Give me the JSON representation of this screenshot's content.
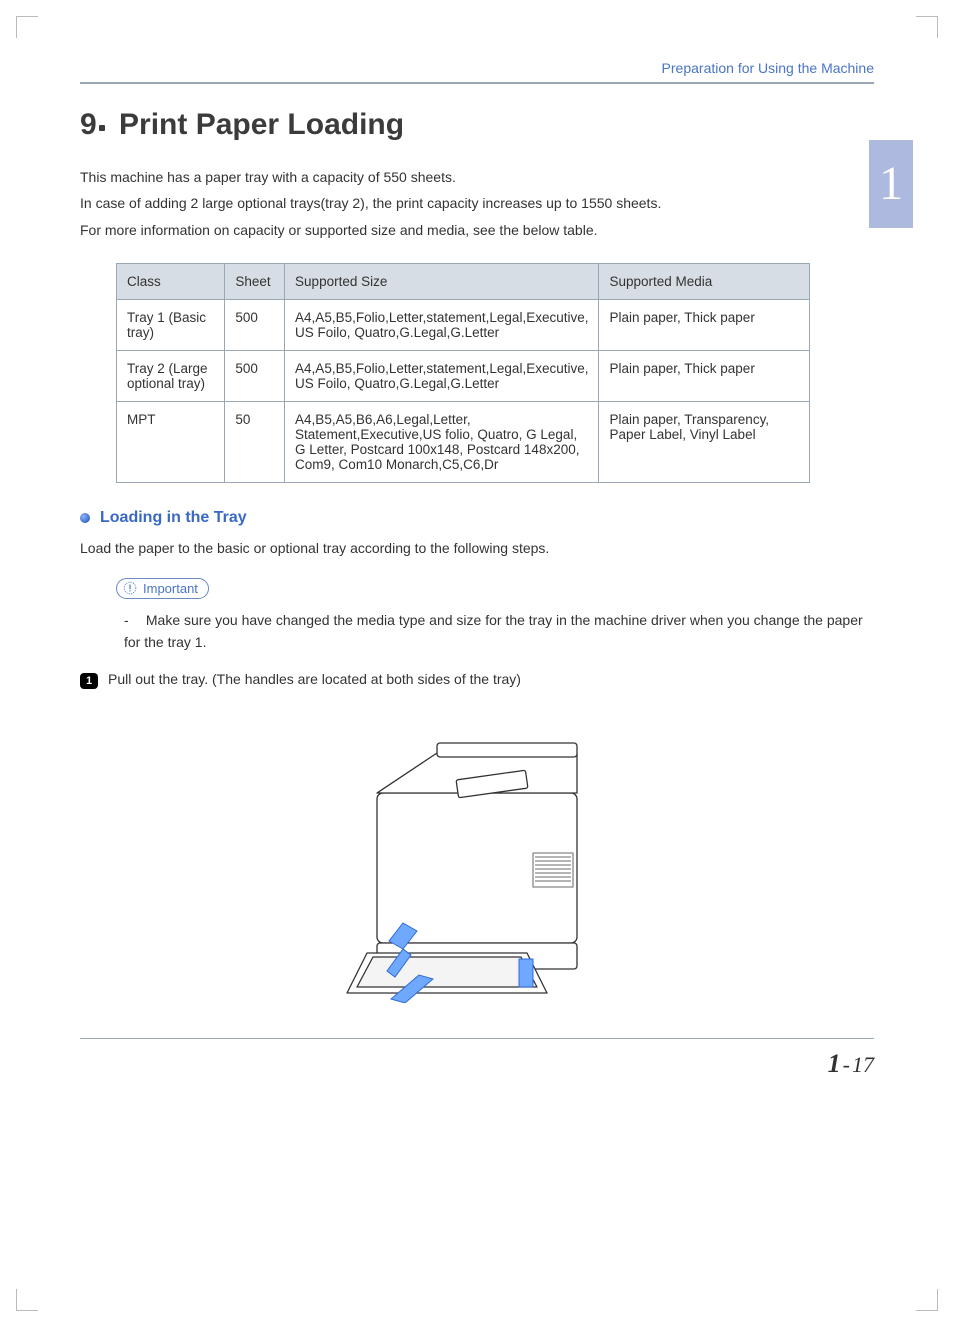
{
  "header": {
    "link_text": "Preparation for Using the Machine"
  },
  "side_tab": {
    "label": "1"
  },
  "title": {
    "number": "9",
    "text": "Print Paper Loading"
  },
  "intro": {
    "p1": "This machine has a paper tray with a capacity of 550 sheets.",
    "p2": "In case of adding 2 large optional trays(tray 2), the print capacity increases up to 1550 sheets.",
    "p3": "For more information on capacity or supported size and media, see the below table."
  },
  "table": {
    "headers": {
      "c1": "Class",
      "c2": "Sheet",
      "c3": "Supported Size",
      "c4": "Supported Media"
    },
    "rows": [
      {
        "c1": "Tray 1 (Basic tray)",
        "c2": "500",
        "c3": "A4,A5,B5,Folio,Letter,statement,Legal,Executive, US Foilo, Quatro,G.Legal,G.Letter",
        "c4": "Plain paper, Thick paper"
      },
      {
        "c1": "Tray 2 (Large optional tray)",
        "c2": "500",
        "c3": "A4,A5,B5,Folio,Letter,statement,Legal,Executive, US Foilo, Quatro,G.Legal,G.Letter",
        "c4": "Plain paper, Thick paper"
      },
      {
        "c1": "MPT",
        "c2": "50",
        "c3": "A4,B5,A5,B6,A6,Legal,Letter, Statement,Executive,US folio, Quatro, G Legal, G Letter, Postcard 100x148, Postcard 148x200, Com9, Com10 Monarch,C5,C6,Dr",
        "c4": "Plain paper, Transparency, Paper Label, Vinyl Label"
      }
    ]
  },
  "subhead": {
    "text": "Loading in the Tray"
  },
  "sub_para": "Load the paper to the basic or optional tray according to the following steps.",
  "important": {
    "label": "Important",
    "item1": "Make sure you have changed the media type and size for the tray in the machine driver when you change the paper for the tray 1."
  },
  "step1": {
    "num": "1",
    "text": "Pull out the tray. (The handles are located at both sides of the tray)"
  },
  "footer": {
    "chapter": "1",
    "page": "17"
  }
}
